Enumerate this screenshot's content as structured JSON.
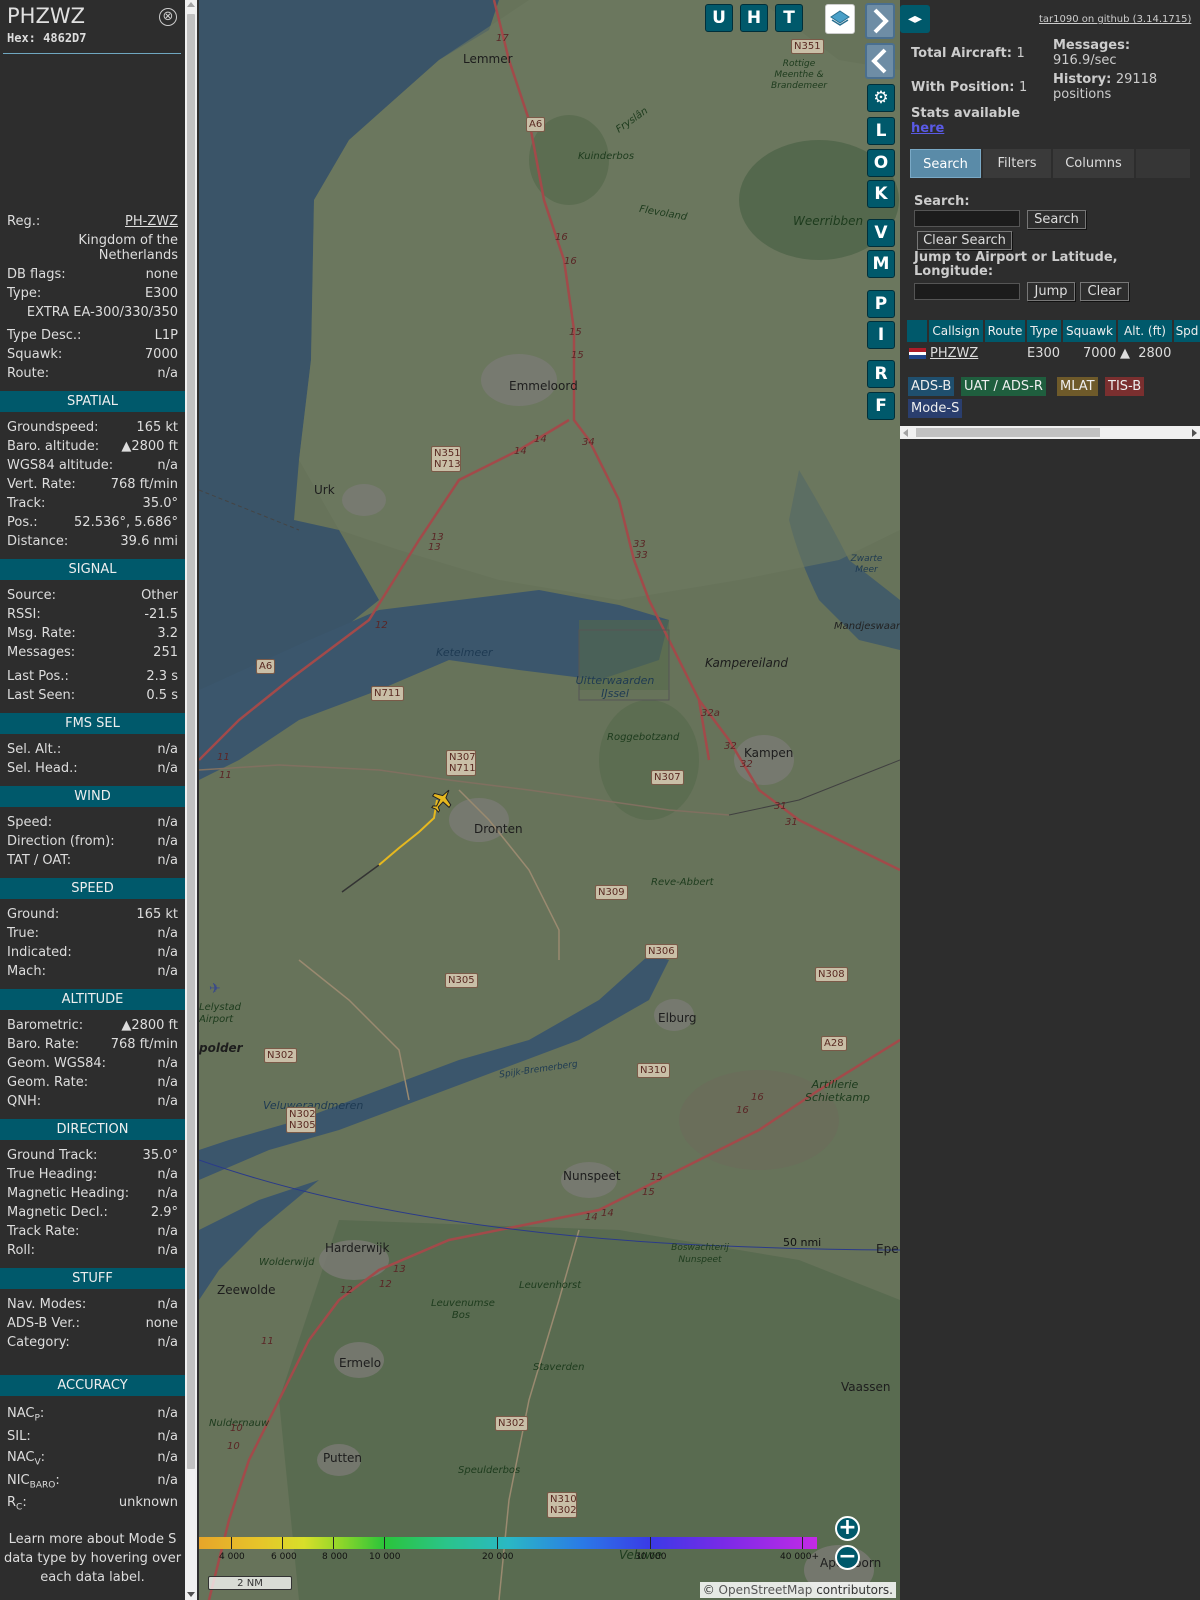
{
  "info": {
    "callsign": "PHZWZ",
    "hex_label": "Hex:",
    "hex": "4862D7",
    "close_glyph": "⊗",
    "reg_label": "Reg.:",
    "reg": "PH-ZWZ",
    "country": "Kingdom of the Netherlands",
    "dbflags_label": "DB flags:",
    "dbflags": "none",
    "type_label": "Type:",
    "type": "E300",
    "type_full": "EXTRA EA-300/330/350",
    "typedesc_label": "Type Desc.:",
    "typedesc": "L1P",
    "squawk_label": "Squawk:",
    "squawk": "7000",
    "route_label": "Route:",
    "route": "n/a",
    "sections": {
      "spatial": "SPATIAL",
      "signal": "SIGNAL",
      "fms": "FMS SEL",
      "wind": "WIND",
      "speed": "SPEED",
      "altitude": "ALTITUDE",
      "direction": "DIRECTION",
      "stuff": "STUFF",
      "accuracy": "ACCURACY"
    },
    "spatial": [
      {
        "label": "Groundspeed:",
        "value": "165 kt"
      },
      {
        "label": "Baro. altitude:",
        "value": "▲2800 ft"
      },
      {
        "label": "WGS84 altitude:",
        "value": "n/a"
      },
      {
        "label": "Vert. Rate:",
        "value": "768 ft/min"
      },
      {
        "label": "Track:",
        "value": "35.0°"
      },
      {
        "label": "Pos.:",
        "value": "52.536°, 5.686°"
      },
      {
        "label": "Distance:",
        "value": "39.6 nmi"
      }
    ],
    "signal": [
      {
        "label": "Source:",
        "value": "Other"
      },
      {
        "label": "RSSI:",
        "value": "-21.5"
      },
      {
        "label": "Msg. Rate:",
        "value": "3.2"
      },
      {
        "label": "Messages:",
        "value": "251"
      },
      {
        "label": "Last Pos.:",
        "value": "2.3 s"
      },
      {
        "label": "Last Seen:",
        "value": "0.5 s"
      }
    ],
    "fms": [
      {
        "label": "Sel. Alt.:",
        "value": "n/a"
      },
      {
        "label": "Sel. Head.:",
        "value": "n/a"
      }
    ],
    "wind": [
      {
        "label": "Speed:",
        "value": "n/a"
      },
      {
        "label": "Direction (from):",
        "value": "n/a"
      },
      {
        "label": "TAT / OAT:",
        "value": "n/a"
      }
    ],
    "speed": [
      {
        "label": "Ground:",
        "value": "165 kt"
      },
      {
        "label": "True:",
        "value": "n/a"
      },
      {
        "label": "Indicated:",
        "value": "n/a"
      },
      {
        "label": "Mach:",
        "value": "n/a"
      }
    ],
    "altitude": [
      {
        "label": "Barometric:",
        "value": "▲2800 ft"
      },
      {
        "label": "Baro. Rate:",
        "value": "768 ft/min"
      },
      {
        "label": "Geom. WGS84:",
        "value": "n/a"
      },
      {
        "label": "Geom. Rate:",
        "value": "n/a"
      },
      {
        "label": "QNH:",
        "value": "n/a"
      }
    ],
    "direction": [
      {
        "label": "Ground Track:",
        "value": "35.0°"
      },
      {
        "label": "True Heading:",
        "value": "n/a"
      },
      {
        "label": "Magnetic Heading:",
        "value": "n/a"
      },
      {
        "label": "Magnetic Decl.:",
        "value": "2.9°"
      },
      {
        "label": "Track Rate:",
        "value": "n/a"
      },
      {
        "label": "Roll:",
        "value": "n/a"
      }
    ],
    "stuff": [
      {
        "label": "Nav. Modes:",
        "value": "n/a"
      },
      {
        "label": "ADS-B Ver.:",
        "value": "none"
      },
      {
        "label": "Category:",
        "value": "n/a"
      }
    ],
    "accuracy": [
      {
        "label": "NAC",
        "sub": "P",
        "colon": ":",
        "value": "n/a"
      },
      {
        "label": "SIL:",
        "sub": "",
        "colon": "",
        "value": "n/a"
      },
      {
        "label": "NAC",
        "sub": "V",
        "colon": ":",
        "value": "n/a"
      },
      {
        "label": "NIC",
        "sub": "BARO",
        "colon": ":",
        "value": "n/a"
      },
      {
        "label": "R",
        "sub": "C",
        "colon": ":",
        "value": "unknown"
      }
    ],
    "footer": "Learn more about Mode S data type by hovering over each data label."
  },
  "map": {
    "buttons_top": [
      "U",
      "H",
      "T"
    ],
    "buttons_side": [
      "L",
      "O",
      "K",
      "V",
      "M",
      "P",
      "I",
      "R",
      "F"
    ],
    "gear_glyph": "⚙",
    "zoom_in": "+",
    "zoom_out": "−",
    "scale": "2 NM",
    "range_ring": "50 nmi",
    "attribution_prefix": "© ",
    "attribution_link": "OpenStreetMap",
    "attribution_suffix": " contributors.",
    "legend_ticks": [
      "4 000",
      "6 000",
      "8 000",
      "10 000",
      "20 000",
      "30 000",
      "40 000+"
    ],
    "towns": [
      "Lemmer",
      "Emmeloord",
      "Urk",
      "Dronten",
      "Kampen",
      "Elburg",
      "Nunspeet",
      "Harderwijk",
      "Zeewolde",
      "Ermelo",
      "Putten",
      "Vaassen",
      "Apeldoorn",
      "Epe",
      "Kampereiland",
      "Mandjeswaard",
      "polder"
    ],
    "water": [
      "Ketelmeer",
      "Uitterwaarden IJssel",
      "Veluwerandmeren",
      "Zwarte Meer",
      "Spijk-Bremerberg"
    ],
    "green": [
      "Kuinderbos",
      "Weerribben",
      "Rottige Meenthe & Brandemeer",
      "Flevoland",
      "Roggebotzand",
      "Reve-Abbert",
      "Artillerie Schietkamp",
      "Leuvenumse Bos",
      "Leuvenhorst",
      "Staverden",
      "Speulderbos",
      "Boswachterij Nunspeet",
      "Wolderwijd",
      "Nuldernauw",
      "Fryslân",
      "Lelystad Airport",
      "Veluwe"
    ],
    "shields": [
      "N351",
      "A6",
      "N351 N713",
      "N711",
      "N307 N711",
      "N307",
      "N309",
      "N306",
      "N305",
      "N302",
      "N302 N305",
      "N310",
      "A28",
      "N308",
      "N302",
      "N310 N302",
      "A6"
    ],
    "junctions": [
      "17",
      "16",
      "16",
      "15",
      "15",
      "14",
      "14",
      "34",
      "33",
      "33",
      "13",
      "13",
      "12",
      "32a",
      "32",
      "32",
      "31",
      "31",
      "11",
      "11",
      "16",
      "16",
      "15",
      "15",
      "14",
      "14",
      "13",
      "12",
      "12",
      "11",
      "10",
      "10"
    ]
  },
  "sidebar": {
    "collapse_glyph": "◂▸",
    "github": "tar1090 on github (3.14.1715)",
    "total_label": "Total Aircraft:",
    "total": "1",
    "withpos_label": "With Position:",
    "withpos": "1",
    "messages_label": "Messages:",
    "messages": "916.9/sec",
    "history_label": "History:",
    "history": "29118 positions",
    "stats_label": "Stats available",
    "stats_link": "here",
    "tabs": [
      "Search",
      "Filters",
      "Columns"
    ],
    "search_label": "Search:",
    "search_button": "Search",
    "clear_search": "Clear Search",
    "jump_label": "Jump to Airport or Latitude, Longitude:",
    "jump_button": "Jump",
    "clear_button": "Clear",
    "columns": [
      "Callsign",
      "Route",
      "Type",
      "Squawk",
      "Alt. (ft)",
      "Spd"
    ],
    "row": {
      "callsign": "PHZWZ",
      "route": "",
      "type": "E300",
      "squawk": "7000",
      "alt": "▲  2800"
    },
    "badges": [
      {
        "label": "ADS-B",
        "color": "#1f4f6e"
      },
      {
        "label": "UAT / ADS-R",
        "color": "#1f5e3e"
      },
      {
        "label": "MLAT",
        "color": "#6e5a2a"
      },
      {
        "label": "TIS-B",
        "color": "#7a2f2f"
      },
      {
        "label": "Mode-S",
        "color": "#2a3e6e"
      }
    ]
  }
}
